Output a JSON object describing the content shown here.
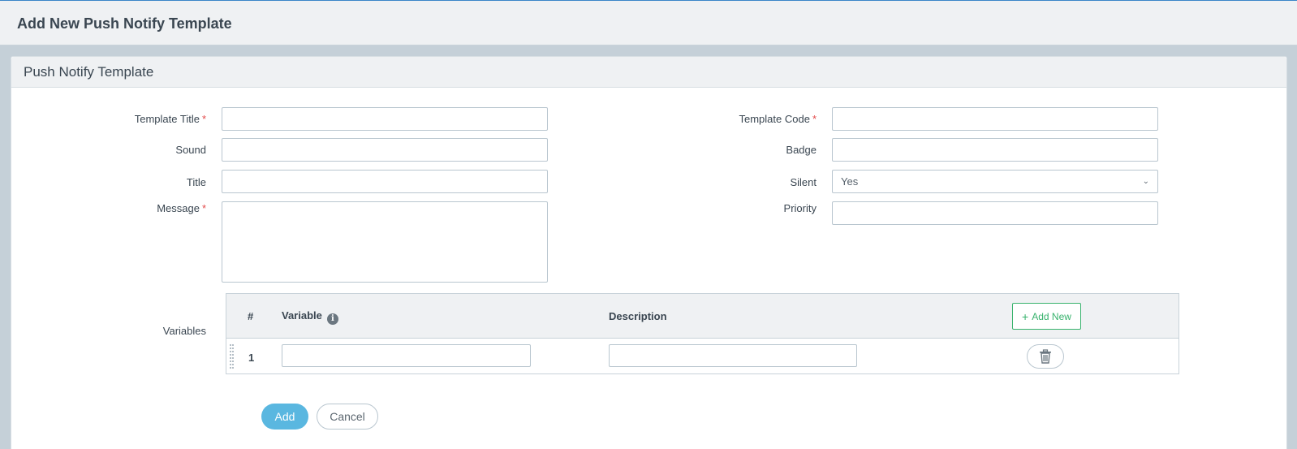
{
  "header": {
    "title": "Add New Push Notify Template"
  },
  "panel": {
    "title": "Push Notify Template"
  },
  "form": {
    "template_title": {
      "label": "Template Title",
      "required": "*",
      "value": ""
    },
    "template_code": {
      "label": "Template Code",
      "required": "*",
      "value": ""
    },
    "sound": {
      "label": "Sound",
      "value": ""
    },
    "badge": {
      "label": "Badge",
      "value": ""
    },
    "title": {
      "label": "Title",
      "value": ""
    },
    "silent": {
      "label": "Silent",
      "value": "Yes"
    },
    "message": {
      "label": "Message",
      "required": "*",
      "value": ""
    },
    "priority": {
      "label": "Priority",
      "value": ""
    }
  },
  "variables": {
    "label": "Variables",
    "columns": {
      "num": "#",
      "variable": "Variable",
      "description": "Description"
    },
    "info_glyph": "i",
    "add_new_label": "Add New",
    "rows": [
      {
        "num": "1",
        "variable": "",
        "description": ""
      }
    ]
  },
  "actions": {
    "add_label": "Add",
    "cancel_label": "Cancel"
  },
  "icons": {
    "info": "info-icon",
    "plus": "plus-icon",
    "trash": "trash-icon",
    "chevron": "chevron-down-icon"
  },
  "colors": {
    "accent": "#5ab7e0",
    "success": "#37b26c",
    "required": "#e34b4b"
  }
}
